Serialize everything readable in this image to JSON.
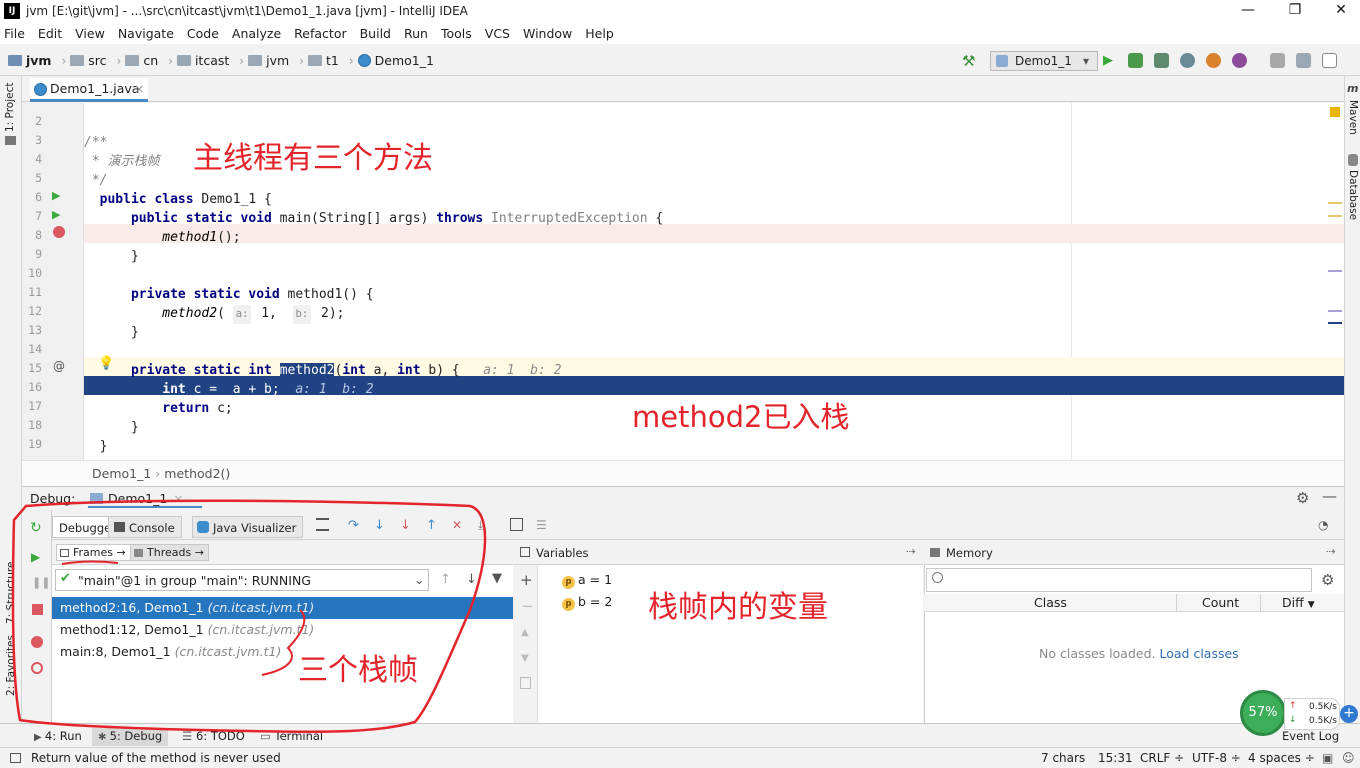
{
  "window": {
    "title": "jvm [E:\\git\\jvm] - ...\\src\\cn\\itcast\\jvm\\t1\\Demo1_1.java [jvm] - IntelliJ IDEA",
    "app_icon": "IJ",
    "minimize": "—",
    "maximize": "❐",
    "close": "✕"
  },
  "menu": [
    "File",
    "Edit",
    "View",
    "Navigate",
    "Code",
    "Analyze",
    "Refactor",
    "Build",
    "Run",
    "Tools",
    "VCS",
    "Window",
    "Help"
  ],
  "nav": {
    "crumbs": [
      "jvm",
      "src",
      "cn",
      "itcast",
      "jvm",
      "t1",
      "Demo1_1"
    ],
    "run_config": "Demo1_1"
  },
  "editor": {
    "tab": "Demo1_1.java",
    "tab_close": "×",
    "line_numbers": [
      "2",
      "3",
      "4",
      "5",
      "6",
      "7",
      "8",
      "9",
      "10",
      "11",
      "12",
      "13",
      "14",
      "15",
      "16",
      "17",
      "18",
      "19"
    ],
    "code": {
      "l3": "/**",
      "l4": " * 演示栈帧",
      "l5": " */",
      "l6_kw": "public class",
      "l6_rest": " Demo1_1 {",
      "l7_kw1": "public static void",
      "l7_mid": " main(String[] args) ",
      "l7_kw2": "throws",
      "l7_exc": " InterruptedException",
      "l7_end": " {",
      "l8": "method1",
      "l8_end": "();",
      "l9": "}",
      "l11_kw": "private static void",
      "l11_rest": " method1() {",
      "l12_call": "method2",
      "l12_open": "( ",
      "l12_hint_a": "a:",
      "l12_a": " 1,  ",
      "l12_hint_b": "b:",
      "l12_b": " 2);",
      "l13": "}",
      "l15_kw": "private static int",
      "l15_name": "method2",
      "l15_p1": "(",
      "l15_int1": "int",
      "l15_a": " a, ",
      "l15_int2": "int",
      "l15_b": " b) {",
      "l15_inline": "a: 1  b: 2",
      "l16_kw": "int",
      "l16_rest": " c =  a + b;",
      "l16_inline": "a: 1  b: 2",
      "l17_kw": "return",
      "l17_rest": " c;",
      "l18": "}",
      "l19": "}"
    },
    "breadcrumb": [
      "Demo1_1",
      "method2()"
    ]
  },
  "annotations": {
    "main_thread": "主线程有三个方法",
    "pushed": "method2已入栈",
    "variables": "栈帧内的变量",
    "three_frames": "三个栈帧"
  },
  "debug": {
    "label": "Debug:",
    "session": "Demo1_1",
    "tabs": [
      "Debugger",
      "Console",
      "Java Visualizer"
    ],
    "frames_tab": "Frames",
    "threads_tab": "Threads",
    "thread": "\"main\"@1 in group \"main\": RUNNING",
    "frames": [
      {
        "name": "method2:16, Demo1_1",
        "pkg": "(cn.itcast.jvm.t1)"
      },
      {
        "name": "method1:12, Demo1_1",
        "pkg": "(cn.itcast.jvm.t1)"
      },
      {
        "name": "main:8, Demo1_1",
        "pkg": "(cn.itcast.jvm.t1)"
      }
    ],
    "variables_title": "Variables",
    "variables": [
      {
        "badge": "p",
        "text": "a = 1"
      },
      {
        "badge": "p",
        "text": "b = 2"
      }
    ],
    "memory_title": "Memory",
    "memory_cols": [
      "Class",
      "Count",
      "Diff"
    ],
    "memory_empty": "No classes loaded.",
    "memory_link": "Load classes"
  },
  "bottom_tabs": [
    "4: Run",
    "5: Debug",
    "6: TODO",
    "Terminal",
    "Event Log"
  ],
  "side_tabs": {
    "project": "1: Project",
    "structure": "7: Structure",
    "favorites": "2: Favorites",
    "maven": "Maven",
    "database": "Database"
  },
  "status": {
    "message": "Return value of the method is never used",
    "chars": "7 chars",
    "position": "15:31",
    "line_sep": "CRLF",
    "encoding": "UTF-8",
    "indent": "4 spaces"
  },
  "net": {
    "percent": "57%",
    "up": "0.5K/s",
    "down": "0.5K/s"
  },
  "colors": {
    "annotation": "#e3242b",
    "selection": "#2675bf",
    "exec_line": "#214283"
  }
}
